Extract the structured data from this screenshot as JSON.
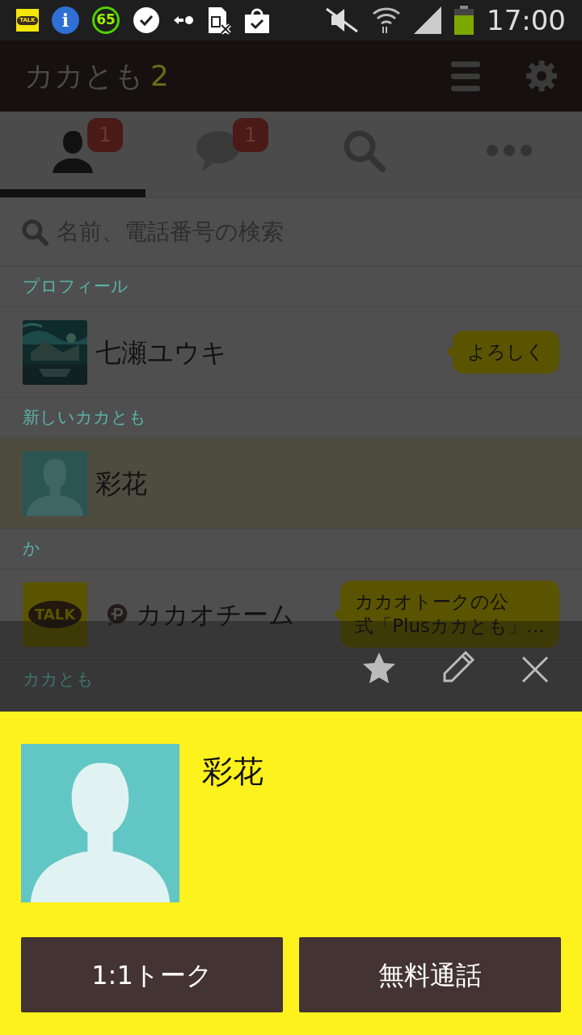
{
  "status_bar": {
    "notifications": [
      {
        "kind": "talk",
        "text": "TALK"
      },
      {
        "kind": "info",
        "text": "i"
      },
      {
        "kind": "ring",
        "text": "65"
      },
      {
        "kind": "check-bubble"
      },
      {
        "kind": "arrow-dot"
      },
      {
        "kind": "sim"
      },
      {
        "kind": "bag"
      }
    ],
    "time": "17:00"
  },
  "header": {
    "title": "カカとも",
    "count": "2"
  },
  "tabs": [
    {
      "kind": "friends",
      "selected": true,
      "badge": "1"
    },
    {
      "kind": "chats",
      "selected": false,
      "badge": "1"
    },
    {
      "kind": "search",
      "selected": false
    },
    {
      "kind": "more",
      "selected": false
    }
  ],
  "search": {
    "placeholder": "名前、電話番号の検索"
  },
  "sections": [
    {
      "header": "プロフィール",
      "rows": [
        {
          "name": "七瀬ユウキ",
          "avatar": {
            "kind": "picture"
          },
          "status": [
            "よろしく"
          ],
          "selected": false
        }
      ]
    },
    {
      "header": "新しいカカとも",
      "rows": [
        {
          "name": "彩花",
          "avatar": {
            "kind": "default"
          },
          "selected": true
        }
      ]
    },
    {
      "header": "か",
      "rows": [
        {
          "name": "カカオチーム",
          "avatar": {
            "kind": "logo"
          },
          "logo_text": "TALK",
          "plus": true,
          "status": [
            "カカオトークの公",
            "式「Plusカカとも」…"
          ],
          "selected": false
        }
      ]
    },
    {
      "header": "カカとも"
    }
  ],
  "profile_sheet": {
    "name": "彩花",
    "buttons": [
      "1:1トーク",
      "無料通話"
    ]
  }
}
